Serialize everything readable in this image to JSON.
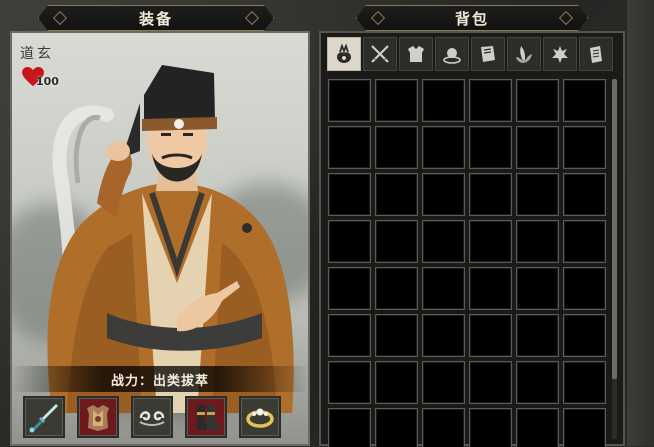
{
  "equipment": {
    "title": "装备",
    "character_name": "道玄",
    "hp": "100",
    "combat_power": "战力：出类拔萃",
    "slots": [
      {
        "name": "sword",
        "icon": "sword-icon",
        "bg": "#3a3c34"
      },
      {
        "name": "armor",
        "icon": "armor-icon",
        "bg": "#6e1a1c"
      },
      {
        "name": "accessory",
        "icon": "swirl-ornament-icon",
        "bg": "#3a3c34"
      },
      {
        "name": "boots",
        "icon": "boots-icon",
        "bg": "#6e1a1c"
      },
      {
        "name": "ring",
        "icon": "ring-icon",
        "bg": "#3a3c34"
      }
    ]
  },
  "bag": {
    "title": "背包",
    "tabs": [
      {
        "icon": "all-items-icon",
        "active": true
      },
      {
        "icon": "weapons-icon",
        "active": false
      },
      {
        "icon": "armor-tab-icon",
        "active": false
      },
      {
        "icon": "pill-icon",
        "active": false
      },
      {
        "icon": "book-icon",
        "active": false
      },
      {
        "icon": "herb-icon",
        "active": false
      },
      {
        "icon": "material-icon",
        "active": false
      },
      {
        "icon": "misc-icon",
        "active": false
      }
    ],
    "grid_columns": 6,
    "grid_rows": 8
  },
  "colors": {
    "accent_gold": "#8a7a55",
    "slot_red": "#6e1a1c",
    "heart_red": "#c8151b"
  }
}
